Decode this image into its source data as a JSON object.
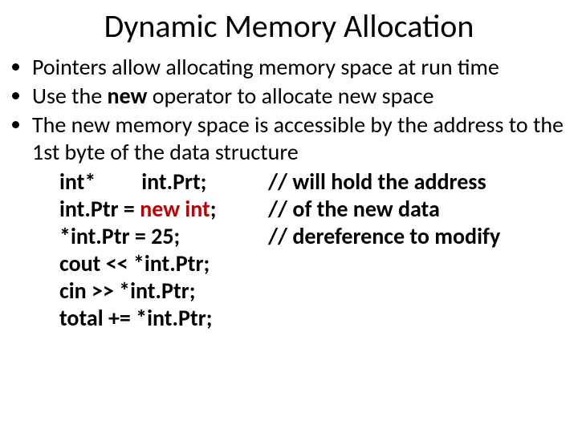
{
  "title": "Dynamic Memory Allocation",
  "bullets": {
    "b1": "Pointers allow allocating memory space at run time",
    "b2_pre": "Use the ",
    "b2_kw": "new",
    "b2_post": " operator to allocate new space",
    "b3": "The new memory space is accessible by the address to the 1st byte of the data structure"
  },
  "code": {
    "l1a": "int*         int.Prt;",
    "l1b": "// will hold the address",
    "l2a_pre": "int.Ptr = ",
    "l2a_kw": "new int",
    "l2a_post": ";",
    "l2b": "// of the new data",
    "l3a": "*int.Ptr = 25;",
    "l3b": "// dereference to modify",
    "l4": "cout << *int.Ptr;",
    "l5": "cin >> *int.Ptr;",
    "l6": "total += *int.Ptr;"
  }
}
